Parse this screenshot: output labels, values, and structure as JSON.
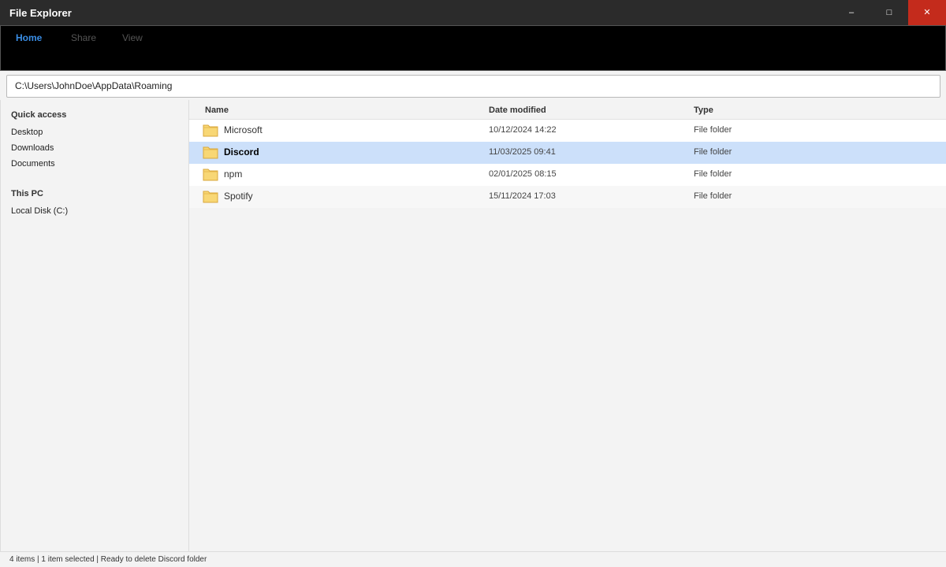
{
  "window": {
    "title": "File Explorer",
    "minimize_glyph": "–",
    "maximize_glyph": "□",
    "close_glyph": "✕",
    "close_color": "#c42b1c"
  },
  "ribbon": {
    "tabs": [
      {
        "label": "Home",
        "active": true
      },
      {
        "label": "Share",
        "active": false
      },
      {
        "label": "View",
        "active": false
      }
    ],
    "accent": "#3a8ee6"
  },
  "address": {
    "path": "C:\\Users\\JohnDoe\\AppData\\Roaming"
  },
  "sidebar": {
    "quick_access": {
      "label": "Quick access",
      "items": [
        "Desktop",
        "Downloads",
        "Documents"
      ]
    },
    "this_pc": {
      "label": "This PC",
      "items": [
        "Local Disk (C:)"
      ]
    }
  },
  "files": {
    "columns": {
      "name": "Name",
      "date": "Date modified",
      "type": "Type"
    },
    "rows": [
      {
        "name": "Microsoft",
        "date": "10/12/2024 14:22",
        "type": "File folder",
        "icon": "folder-icon",
        "selected": false
      },
      {
        "name": "Discord",
        "date": "11/03/2025 09:41",
        "type": "File folder",
        "icon": "folder-icon",
        "selected": true
      },
      {
        "name": "npm",
        "date": "02/01/2025 08:15",
        "type": "File folder",
        "icon": "folder-icon",
        "selected": false
      },
      {
        "name": "Spotify",
        "date": "15/11/2024 17:03",
        "type": "File folder",
        "icon": "folder-icon",
        "selected": false
      }
    ],
    "selection_color": "#cce0fa"
  },
  "status": {
    "text": "4 items | 1 item selected | Ready to delete Discord folder"
  }
}
